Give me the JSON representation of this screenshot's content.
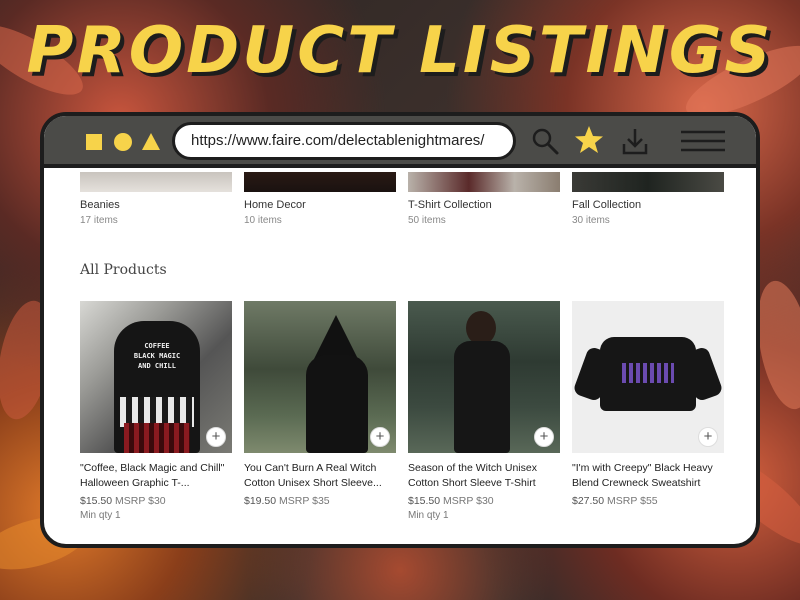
{
  "headline": "PRODUCT LISTINGS",
  "browser": {
    "url": "https://www.faire.com/delectablenightmares/",
    "icons": [
      "square-icon",
      "circle-icon",
      "triangle-icon",
      "search-icon",
      "star-icon",
      "download-icon",
      "menu-icon"
    ],
    "accent": "#f7d34a"
  },
  "categories": [
    {
      "name": "Beanies",
      "count": "17 items"
    },
    {
      "name": "Home Decor",
      "count": "10 items"
    },
    {
      "name": "T-Shirt Collection",
      "count": "50 items"
    },
    {
      "name": "Fall Collection",
      "count": "30 items"
    }
  ],
  "section_title": "All Products",
  "products": [
    {
      "title": "\"Coffee, Black Magic and Chill\" Halloween Graphic T-...",
      "price": "$15.50",
      "msrp": "MSRP $30",
      "min_qty": "Min qty 1",
      "img_text": "COFFEE BLACK MAGIC AND CHILL"
    },
    {
      "title": "You Can't Burn A Real Witch Cotton Unisex Short Sleeve...",
      "price": "$19.50",
      "msrp": "MSRP $35",
      "min_qty": ""
    },
    {
      "title": "Season of the Witch Unisex Cotton Short Sleeve T-Shirt",
      "price": "$15.50",
      "msrp": "MSRP $30",
      "min_qty": "Min qty 1"
    },
    {
      "title": "\"I'm with Creepy\" Black Heavy Blend Crewneck Sweatshirt",
      "price": "$27.50",
      "msrp": "MSRP $55",
      "min_qty": ""
    }
  ],
  "add_symbol": "+"
}
